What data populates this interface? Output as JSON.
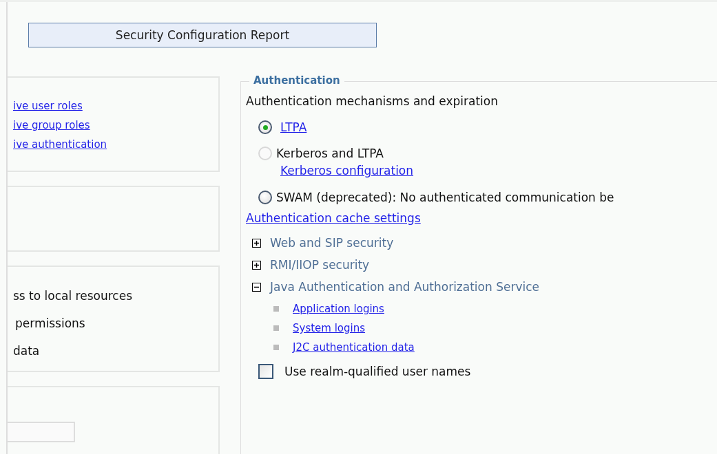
{
  "report_button": "Security Configuration Report",
  "left_panels": [
    {
      "kind": "links",
      "items": [
        "ive user roles",
        "ive group roles",
        "ive authentication"
      ]
    },
    {
      "kind": "empty"
    },
    {
      "kind": "texts",
      "items": [
        "ss to local resources",
        "permissions",
        "data"
      ]
    },
    {
      "kind": "field"
    }
  ],
  "authentication": {
    "legend": "Authentication",
    "heading": "Authentication mechanisms and expiration",
    "options": [
      {
        "label": "LTPA",
        "kind": "link",
        "selected": true,
        "disabled": false
      },
      {
        "label": "Kerberos and LTPA",
        "kind": "text",
        "selected": false,
        "disabled": true,
        "sublink": "Kerberos configuration"
      },
      {
        "label": "SWAM (deprecated): No authenticated communication be",
        "kind": "text",
        "selected": false,
        "disabled": false
      }
    ],
    "cache_link": "Authentication cache settings",
    "sections": [
      {
        "title": "Web and SIP security",
        "expanded": false
      },
      {
        "title": "RMI/IIOP security",
        "expanded": false
      },
      {
        "title": "Java Authentication and Authorization Service",
        "expanded": true,
        "children": [
          "Application logins",
          "System logins",
          "J2C authentication data"
        ]
      }
    ],
    "checkbox": {
      "label": "Use realm-qualified user names",
      "checked": false
    }
  }
}
